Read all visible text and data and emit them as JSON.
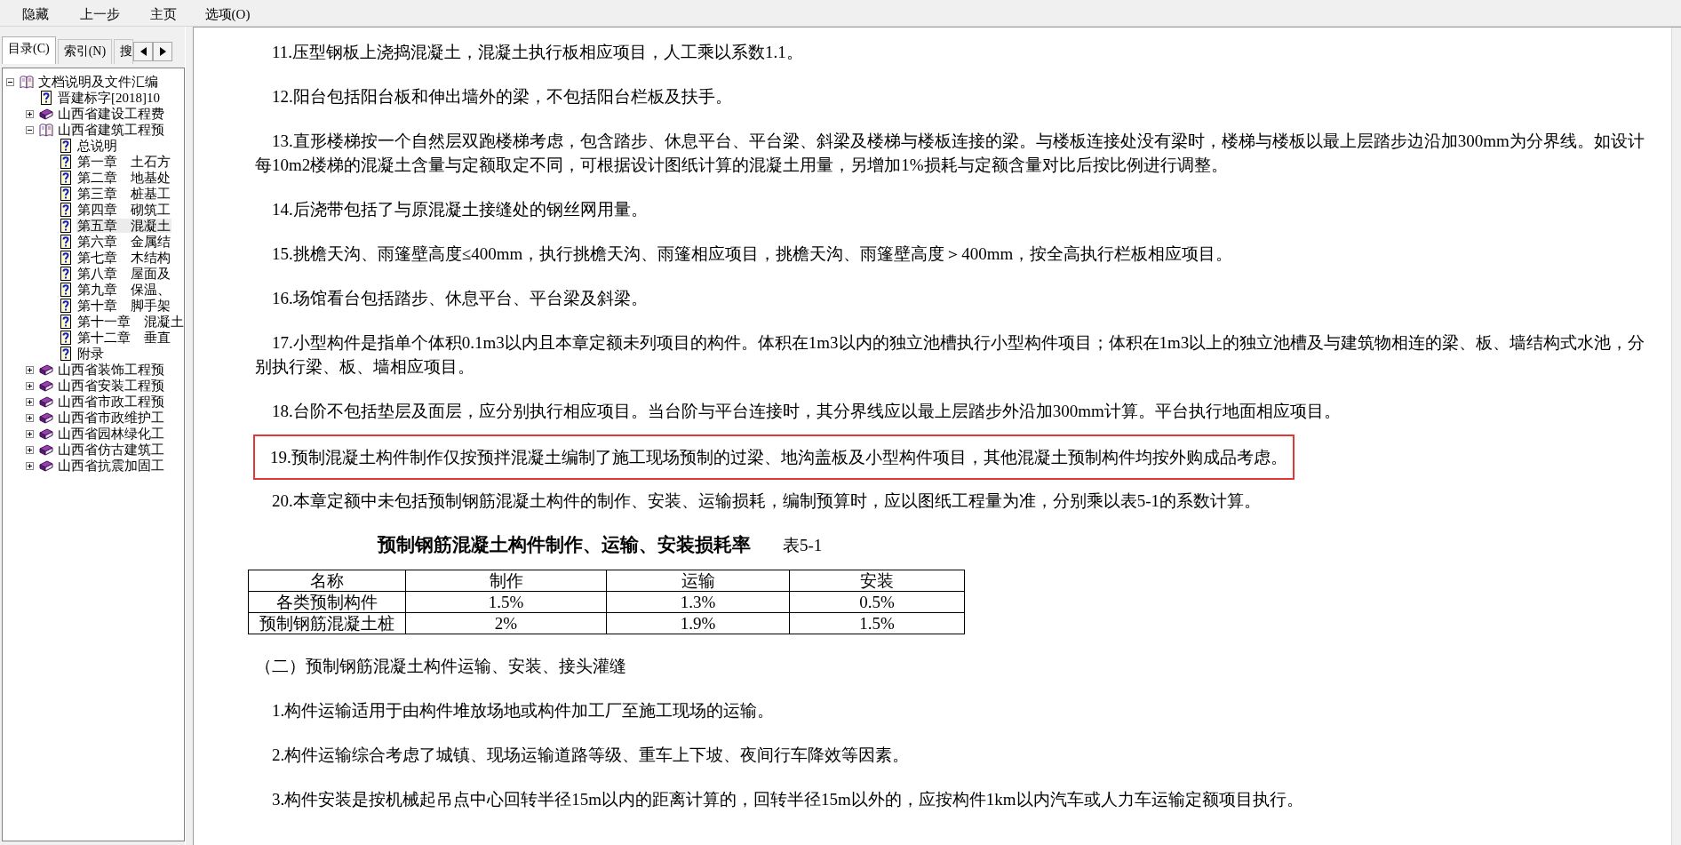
{
  "toolbar": {
    "buttons": [
      "隐藏",
      "上一步",
      "主页",
      "选项(O)"
    ]
  },
  "nav_tabs": [
    {
      "label": "目录(C)",
      "selected": true
    },
    {
      "label": "索引(N)",
      "selected": false
    },
    {
      "label": "搜",
      "selected": false
    }
  ],
  "tree": [
    {
      "label": "文档说明及文件汇编",
      "kind": "book",
      "expanded": true,
      "selected": false,
      "children": [
        {
          "label": "晋建标字[2018]10",
          "kind": "page",
          "selected": false
        },
        {
          "label": "山西省建设工程费",
          "kind": "book",
          "expanded": false,
          "selected": false
        },
        {
          "label": "山西省建筑工程预",
          "kind": "book",
          "expanded": true,
          "selected": false,
          "children": [
            {
              "label": "总说明",
              "kind": "page",
              "selected": false
            },
            {
              "label": "第一章　土石方",
              "kind": "page",
              "selected": false
            },
            {
              "label": "第二章　地基处",
              "kind": "page",
              "selected": false
            },
            {
              "label": "第三章　桩基工",
              "kind": "page",
              "selected": false
            },
            {
              "label": "第四章　砌筑工",
              "kind": "page",
              "selected": false
            },
            {
              "label": "第五章　混凝土",
              "kind": "page",
              "selected": true
            },
            {
              "label": "第六章　金属结",
              "kind": "page",
              "selected": false
            },
            {
              "label": "第七章　木结构",
              "kind": "page",
              "selected": false
            },
            {
              "label": "第八章　屋面及",
              "kind": "page",
              "selected": false
            },
            {
              "label": "第九章　保温、",
              "kind": "page",
              "selected": false
            },
            {
              "label": "第十章　脚手架",
              "kind": "page",
              "selected": false
            },
            {
              "label": "第十一章　混凝土",
              "kind": "page",
              "selected": false
            },
            {
              "label": "第十二章　垂直",
              "kind": "page",
              "selected": false
            },
            {
              "label": "附录",
              "kind": "page",
              "selected": false
            }
          ]
        },
        {
          "label": "山西省装饰工程预",
          "kind": "book",
          "expanded": false,
          "selected": false
        },
        {
          "label": "山西省安装工程预",
          "kind": "book",
          "expanded": false,
          "selected": false
        },
        {
          "label": "山西省市政工程预",
          "kind": "book",
          "expanded": false,
          "selected": false
        },
        {
          "label": "山西省市政维护工",
          "kind": "book",
          "expanded": false,
          "selected": false
        },
        {
          "label": "山西省园林绿化工",
          "kind": "book",
          "expanded": false,
          "selected": false
        },
        {
          "label": "山西省仿古建筑工",
          "kind": "book",
          "expanded": false,
          "selected": false
        },
        {
          "label": "山西省抗震加固工",
          "kind": "book",
          "expanded": false,
          "selected": false
        }
      ]
    }
  ],
  "content": [
    {
      "kind": "paragraph",
      "boxed": false,
      "text": "11.压型钢板上浇捣混凝土，混凝土执行板相应项目，人工乘以系数1.1。"
    },
    {
      "kind": "paragraph",
      "boxed": false,
      "text": "12.阳台包括阳台板和伸出墙外的梁，不包括阳台栏板及扶手。"
    },
    {
      "kind": "paragraph",
      "boxed": false,
      "text": "13.直形楼梯按一个自然层双跑楼梯考虑，包含踏步、休息平台、平台梁、斜梁及楼梯与楼板连接的梁。与楼板连接处没有梁时，楼梯与楼板以最上层踏步边沿加300mm为分界线。如设计每10m2楼梯的混凝土含量与定额取定不同，可根据设计图纸计算的混凝土用量，另增加1%损耗与定额含量对比后按比例进行调整。"
    },
    {
      "kind": "paragraph",
      "boxed": false,
      "text": "14.后浇带包括了与原混凝土接缝处的钢丝网用量。"
    },
    {
      "kind": "paragraph",
      "boxed": false,
      "text": "15.挑檐天沟、雨篷壁高度≤400mm，执行挑檐天沟、雨篷相应项目，挑檐天沟、雨篷壁高度＞400mm，按全高执行栏板相应项目。"
    },
    {
      "kind": "paragraph",
      "boxed": false,
      "text": "16.场馆看台包括踏步、休息平台、平台梁及斜梁。"
    },
    {
      "kind": "paragraph",
      "boxed": false,
      "text": "17.小型构件是指单个体积0.1m3以内且本章定额未列项目的构件。体积在1m3以内的独立池槽执行小型构件项目；体积在1m3以上的独立池槽及与建筑物相连的梁、板、墙结构式水池，分别执行梁、板、墙相应项目。"
    },
    {
      "kind": "paragraph",
      "boxed": false,
      "text": "18.台阶不包括垫层及面层，应分别执行相应项目。当台阶与平台连接时，其分界线应以最上层踏步外沿加300mm计算。平台执行地面相应项目。"
    },
    {
      "kind": "paragraph",
      "boxed": true,
      "text": "19.预制混凝土构件制作仅按预拌混凝土编制了施工现场预制的过梁、地沟盖板及小型构件项目，其他混凝土预制构件均按外购成品考虑。"
    },
    {
      "kind": "paragraph",
      "boxed": false,
      "text": "20.本章定额中未包括预制钢筋混凝土构件的制作、安装、运输损耗，编制预算时，应以图纸工程量为准，分别乘以表5-1的系数计算。"
    },
    {
      "kind": "table_caption",
      "title": "预制钢筋混凝土构件制作、运输、安装损耗率",
      "number": "表5-1"
    },
    {
      "kind": "table",
      "columns": [
        "名称",
        "制作",
        "运输",
        "安装"
      ],
      "rows": [
        [
          "各类预制构件",
          "1.5%",
          "1.3%",
          "0.5%"
        ],
        [
          "预制钢筋混凝土桩",
          "2%",
          "1.9%",
          "1.5%"
        ]
      ]
    },
    {
      "kind": "subheading",
      "text": "（二）预制钢筋混凝土构件运输、安装、接头灌缝"
    },
    {
      "kind": "paragraph",
      "boxed": false,
      "text": "1.构件运输适用于由构件堆放场地或构件加工厂至施工现场的运输。"
    },
    {
      "kind": "paragraph",
      "boxed": false,
      "text": "2.构件运输综合考虑了城镇、现场运输道路等级、重车上下坡、夜间行车降效等因素。"
    },
    {
      "kind": "paragraph",
      "boxed": false,
      "text": "3.构件安装是按机械起吊点中心回转半径15m以内的距离计算的，回转半径15m以外的，应按构件1km以内汽车或人力车运输定额项目执行。"
    }
  ]
}
